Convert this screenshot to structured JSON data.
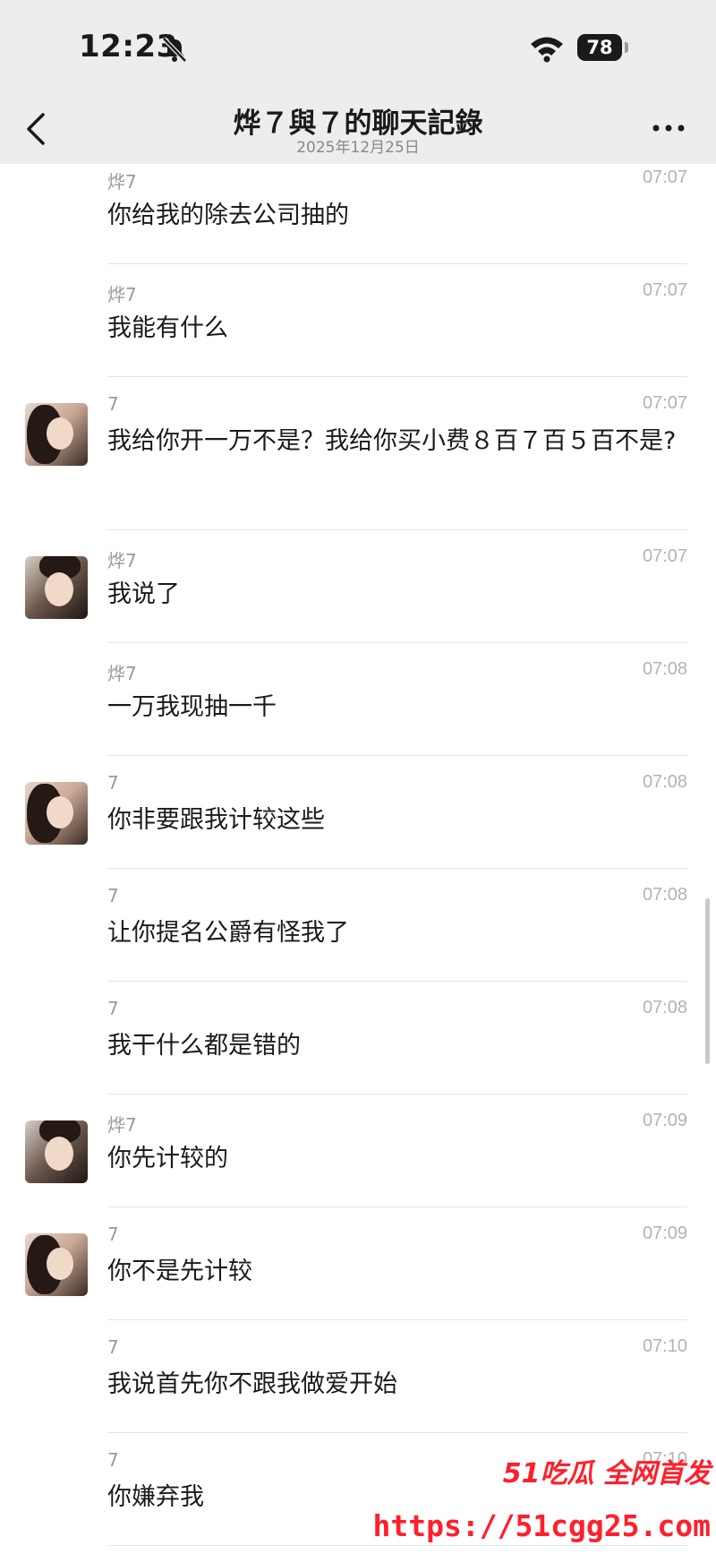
{
  "status_bar": {
    "time": "12:23",
    "battery": "78"
  },
  "nav": {
    "title": "烨７與７的聊天記錄",
    "subtitle": "2025年12月25日"
  },
  "messages": [
    {
      "sender": "烨7",
      "time": "07:07",
      "text": "你给我的除去公司抽的",
      "avatar": null
    },
    {
      "sender": "烨7",
      "time": "07:07",
      "text": "我能有什么",
      "avatar": null
    },
    {
      "sender": "7",
      "time": "07:07",
      "text": "我给你开一万不是？我给你买小费８百７百５百不是?",
      "avatar": "female-avatar"
    },
    {
      "sender": "烨7",
      "time": "07:07",
      "text": "我说了",
      "avatar": "male-avatar"
    },
    {
      "sender": "烨7",
      "time": "07:08",
      "text": "一万我现抽一千",
      "avatar": null
    },
    {
      "sender": "7",
      "time": "07:08",
      "text": "你非要跟我计较这些",
      "avatar": "female-avatar"
    },
    {
      "sender": "7",
      "time": "07:08",
      "text": "让你提名公爵有怪我了",
      "avatar": null
    },
    {
      "sender": "7",
      "time": "07:08",
      "text": "我干什么都是错的",
      "avatar": null
    },
    {
      "sender": "烨7",
      "time": "07:09",
      "text": "你先计较的",
      "avatar": "male-avatar"
    },
    {
      "sender": "7",
      "time": "07:09",
      "text": "你不是先计较",
      "avatar": "female-avatar"
    },
    {
      "sender": "7",
      "time": "07:10",
      "text": "我说首先你不跟我做爱开始",
      "avatar": null
    },
    {
      "sender": "7",
      "time": "07:10",
      "text": "你嫌弃我",
      "avatar": null
    }
  ],
  "watermark": {
    "top": "51吃瓜 全网首发",
    "url": "https://51cgg25.com"
  },
  "colors": {
    "header_bg": "#ededed",
    "watermark": "#ff1f2b"
  }
}
